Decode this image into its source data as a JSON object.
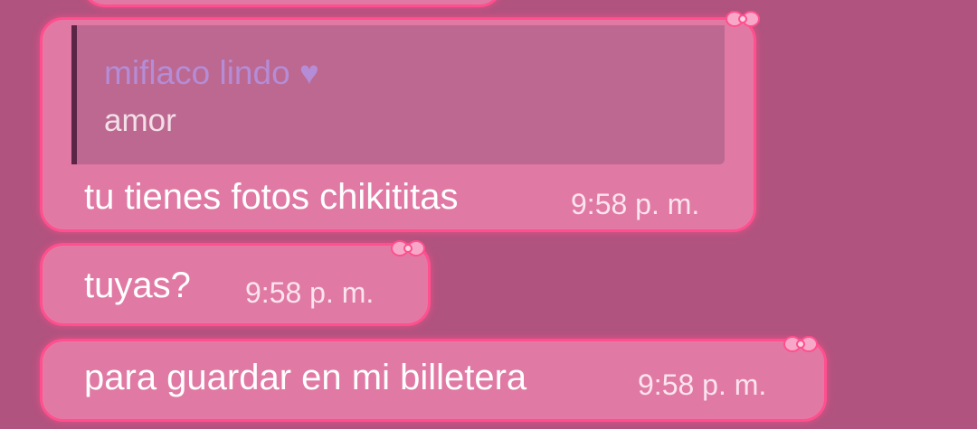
{
  "chat": {
    "messages": [
      {
        "quote": {
          "name": "miflaco lindo ♥",
          "text": "amor"
        },
        "text": "tu tienes fotos chikititas",
        "time": "9:58 p. m."
      },
      {
        "text": "tuyas?",
        "time": "9:58 p. m."
      },
      {
        "text": "para guardar en mi billetera",
        "time": "9:58 p. m."
      }
    ]
  },
  "colors": {
    "background": "#b1537f",
    "bubble": "#e07aa5",
    "bubble_border": "#ff4f8e",
    "quote_background": "#bc6890",
    "quote_bar": "#5a2546",
    "quote_name": "#b58cd6",
    "text": "#ffffff"
  },
  "icons": {
    "bubble_decoration": "bow-icon"
  }
}
